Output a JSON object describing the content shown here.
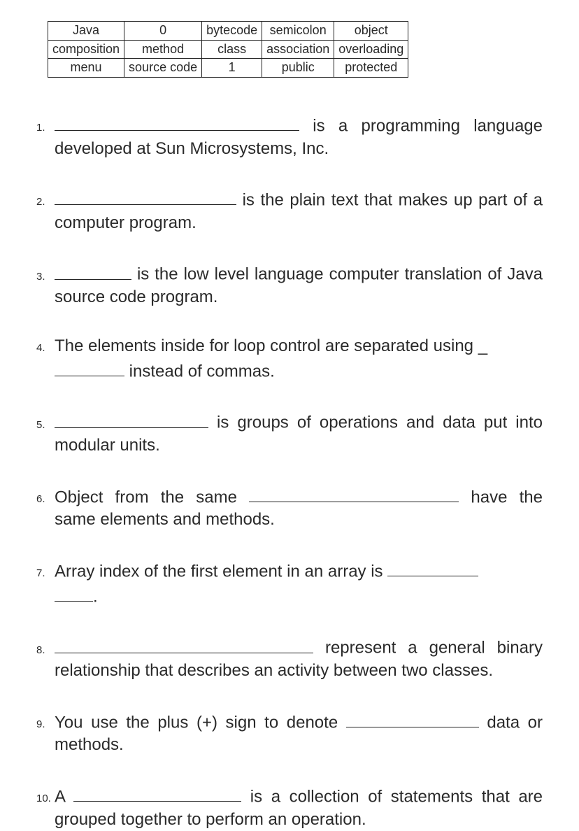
{
  "wordbank": {
    "rows": [
      [
        "Java",
        "0",
        "bytecode",
        "semicolon",
        "object"
      ],
      [
        "composition",
        "method",
        "class",
        "association",
        "overloading"
      ],
      [
        "menu",
        "source code",
        "1",
        "public",
        "protected"
      ]
    ]
  },
  "questions": [
    {
      "num": "1.",
      "parts": [
        "",
        " is a programming language developed at Sun Microsystems, Inc."
      ]
    },
    {
      "num": "2.",
      "parts": [
        "",
        " is the plain text that makes up part of a computer program."
      ]
    },
    {
      "num": "3.",
      "parts": [
        "",
        " is the low level language computer translation of Java source code program."
      ]
    },
    {
      "num": "4.",
      "parts": [
        "The elements inside for loop control are separated using ",
        " ",
        " instead of commas."
      ]
    },
    {
      "num": "5.",
      "parts": [
        "",
        " is groups of operations and data put into modular units."
      ]
    },
    {
      "num": "6.",
      "parts": [
        "Object from the same ",
        " have the same elements and methods."
      ]
    },
    {
      "num": "7.",
      "parts": [
        "Array index of the first element in an array is ",
        " ",
        "."
      ]
    },
    {
      "num": "8.",
      "parts": [
        "",
        " represent a general binary relationship that describes an activity between two classes."
      ]
    },
    {
      "num": "9.",
      "parts": [
        "You use the plus (+) sign to denote ",
        " data or methods."
      ]
    },
    {
      "num": "10.",
      "parts": [
        "A ",
        " is a collection of statements that are grouped together to perform an operation."
      ]
    }
  ]
}
